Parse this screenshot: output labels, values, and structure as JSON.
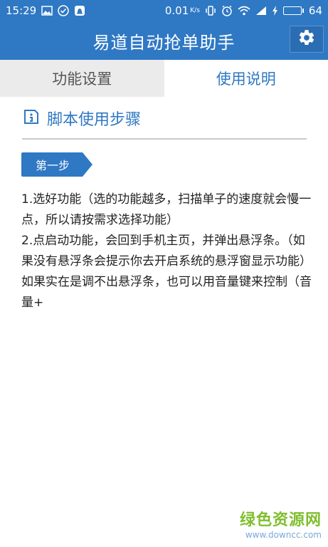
{
  "status_bar": {
    "time": "15:29",
    "network_speed": "0.01",
    "speed_unit": "K/s",
    "battery": "64",
    "battery_level": 0.64
  },
  "app_bar": {
    "title": "易道自动抢单助手"
  },
  "tabs": [
    {
      "label": "功能设置",
      "active": false
    },
    {
      "label": "使用说明",
      "active": true
    }
  ],
  "section": {
    "title": "脚本使用步骤"
  },
  "step": {
    "label": "第一步",
    "text": "1.选好功能（选的功能越多，扫描单子的速度就会慢一点，所以请按需求选择功能）\n2.点启动功能，会回到手机主页，并弹出悬浮条。（如果没有悬浮条会提示你去开启系统的悬浮窗显示功能）如果实在是调不出悬浮条，也可以用音量键来控制（音量+"
  },
  "watermark": {
    "name": "绿色资源网",
    "url": "www.downcc.com"
  },
  "colors": {
    "primary": "#2f78c4",
    "tab_inactive_bg": "#ebebeb",
    "watermark_green": "#7fbf2e"
  }
}
